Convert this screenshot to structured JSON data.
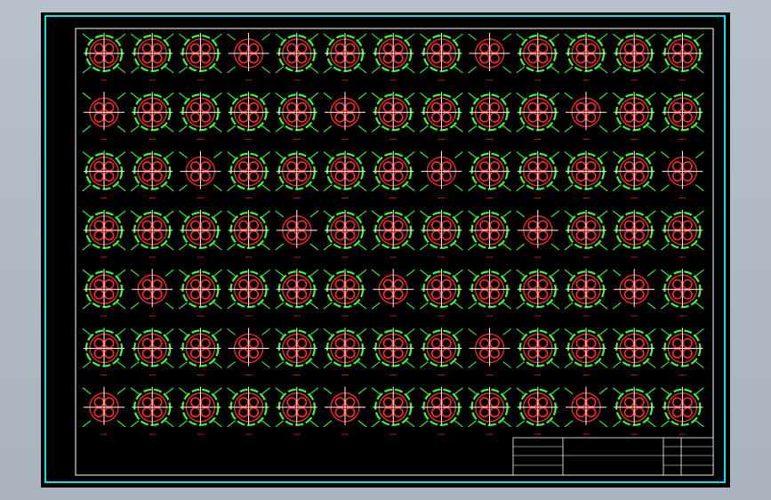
{
  "drawing": {
    "rows": 7,
    "cols": 13,
    "label_text": "---",
    "colors": {
      "frame": "#00e5e5",
      "inner_border": "#ffffff",
      "circle": "#ff2a2a",
      "rebar": "#33ff33",
      "crosshair": "#ffffff",
      "label": "#ff2a2a",
      "background": "#000000",
      "viewport": "#b8c1cb"
    }
  },
  "title_block": {
    "left_labels": [
      "",
      "",
      "",
      ""
    ],
    "drawing_title": "",
    "right_rows": [
      {
        "key": "",
        "value": ""
      },
      {
        "key": "",
        "value": ""
      },
      {
        "key": "",
        "value": ""
      }
    ]
  }
}
